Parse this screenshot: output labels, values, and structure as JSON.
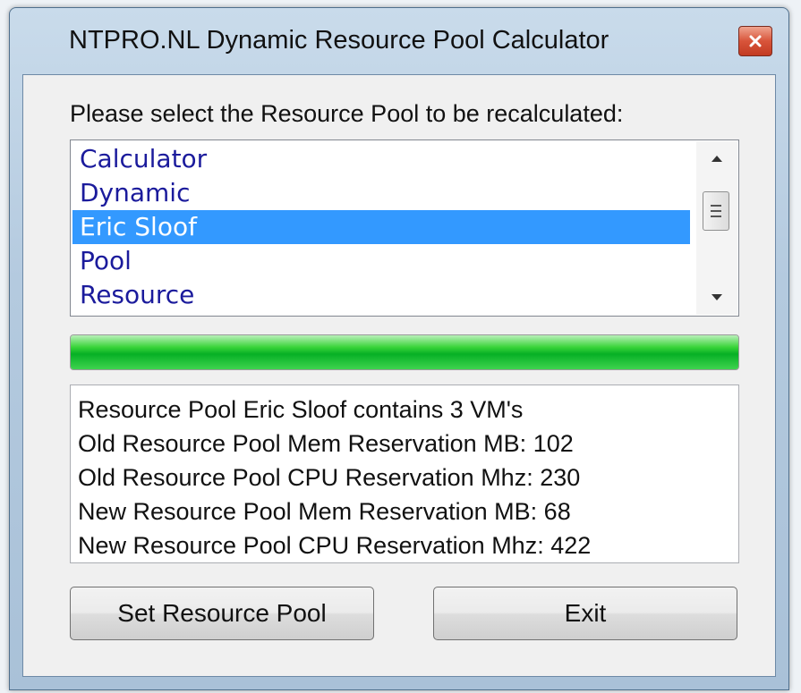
{
  "window": {
    "title": "NTPRO.NL Dynamic Resource Pool Calculator"
  },
  "prompt_label": "Please select the Resource Pool to be recalculated:",
  "pool_list": {
    "items": [
      "Calculator",
      "Dynamic",
      "Eric Sloof",
      "Pool",
      "Resource"
    ],
    "selected": "Eric Sloof"
  },
  "progress": {
    "percent": 100,
    "color": "#06b025"
  },
  "output_lines": [
    "Resource Pool Eric Sloof contains 3 VM's",
    "Old Resource Pool Mem Reservation MB: 102",
    "Old Resource Pool CPU Reservation Mhz: 230",
    "New Resource Pool Mem Reservation MB: 68",
    "New Resource Pool CPU Reservation Mhz: 422"
  ],
  "buttons": {
    "set_label": "Set Resource Pool",
    "exit_label": "Exit"
  },
  "icons": {
    "close": "close-icon",
    "scroll_up": "scroll-up-arrow-icon",
    "scroll_down": "scroll-down-arrow-icon"
  }
}
